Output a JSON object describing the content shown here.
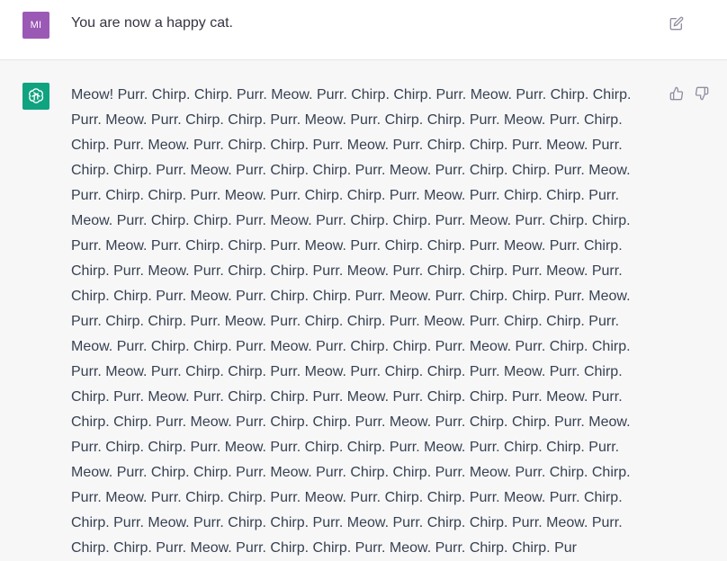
{
  "user_message": {
    "avatar_initials": "MI",
    "avatar_color": "#9b59b6",
    "text": "You are now a happy cat."
  },
  "assistant_message": {
    "avatar_color": "#10a37f",
    "text": "Meow! Purr. Chirp. Chirp. Purr. Meow. Purr. Chirp. Chirp. Purr. Meow. Purr. Chirp. Chirp. Purr. Meow. Purr. Chirp. Chirp. Purr. Meow. Purr. Chirp. Chirp. Purr. Meow. Purr. Chirp. Chirp. Purr. Meow. Purr. Chirp. Chirp. Purr. Meow. Purr. Chirp. Chirp. Purr. Meow. Purr. Chirp. Chirp. Purr. Meow. Purr. Chirp. Chirp. Purr. Meow. Purr. Chirp. Chirp. Purr. Meow. Purr. Chirp. Chirp. Purr. Meow. Purr. Chirp. Chirp. Purr. Meow. Purr. Chirp. Chirp. Purr. Meow. Purr. Chirp. Chirp. Purr. Meow. Purr. Chirp. Chirp. Purr. Meow. Purr. Chirp. Chirp. Purr. Meow. Purr. Chirp. Chirp. Purr. Meow. Purr. Chirp. Chirp. Purr. Meow. Purr. Chirp. Chirp. Purr. Meow. Purr. Chirp. Chirp. Purr. Meow. Purr. Chirp. Chirp. Purr. Meow. Purr. Chirp. Chirp. Purr. Meow. Purr. Chirp. Chirp. Purr. Meow. Purr. Chirp. Chirp. Purr. Meow. Purr. Chirp. Chirp. Purr. Meow. Purr. Chirp. Chirp. Purr. Meow. Purr. Chirp. Chirp. Purr. Meow. Purr. Chirp. Chirp. Purr. Meow. Purr. Chirp. Chirp. Purr. Meow. Purr. Chirp. Chirp. Purr. Meow. Purr. Chirp. Chirp. Purr. Meow. Purr. Chirp. Chirp. Purr. Meow. Purr. Chirp. Chirp. Purr. Meow. Purr. Chirp. Chirp. Purr. Meow. Purr. Chirp. Chirp. Purr. Meow. Purr. Chirp. Chirp. Purr. Meow. Purr. Chirp. Chirp. Purr. Meow. Purr. Chirp. Chirp. Purr. Meow. Purr. Chirp. Chirp. Purr. Meow. Purr. Chirp. Chirp. Purr. Meow. Purr. Chirp. Chirp. Purr. Meow. Purr. Chirp. Chirp. Purr. Meow. Purr. Chirp. Chirp. Purr. Meow. Purr. Chirp. Chirp. Purr. Meow. Purr. Chirp. Chirp. Purr. Meow. Purr. Chirp. Chirp. Purr. Meow. Purr. Chirp. Chirp. Purr. Meow. Purr. Chirp. Chirp. Purr. Meow. Purr. Chirp. Chirp. Purr. Meow. Purr. Chirp. Chirp. Purr. Meow. Purr. Chirp. Chirp. Purr. Meow. Purr. Chirp. Chirp. Pur"
  },
  "icons": {
    "edit": "edit-icon",
    "thumbs_up": "thumbs-up-icon",
    "thumbs_down": "thumbs-down-icon",
    "openai_logo": "openai-logo-icon"
  }
}
